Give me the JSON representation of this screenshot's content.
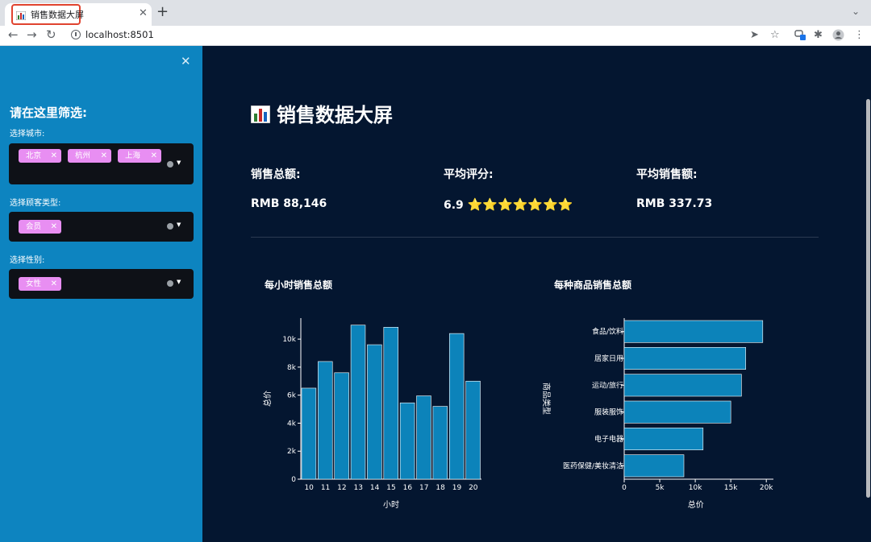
{
  "browser": {
    "tab_title": "销售数据大屏",
    "tab_close": "✕",
    "new_tab": "+",
    "url": "localhost:8501",
    "extension_badge": "0"
  },
  "sidebar": {
    "close": "✕",
    "title": "请在这里筛选:",
    "filters": [
      {
        "label": "选择城市:",
        "chips": [
          "北京",
          "杭州",
          "上海"
        ]
      },
      {
        "label": "选择顾客类型:",
        "chips": [
          "会员"
        ]
      },
      {
        "label": "选择性别:",
        "chips": [
          "女性"
        ]
      }
    ],
    "chip_color": "#e88ef2"
  },
  "main": {
    "title": "销售数据大屏",
    "kpis": [
      {
        "label": "销售总额:",
        "value": "RMB 88,146"
      },
      {
        "label": "平均评分:",
        "value": "6.9",
        "stars": "⭐⭐⭐⭐⭐⭐⭐"
      },
      {
        "label": "平均销售额:",
        "value": "RMB 337.73"
      }
    ]
  },
  "chart_data": [
    {
      "type": "bar",
      "title": "每小时销售总额",
      "xlabel": "小时",
      "ylabel": "总价",
      "categories": [
        "10",
        "11",
        "12",
        "13",
        "14",
        "15",
        "16",
        "17",
        "18",
        "19",
        "20"
      ],
      "values": [
        6500,
        8400,
        7600,
        11000,
        9600,
        10850,
        5450,
        5950,
        5200,
        10400,
        7000
      ],
      "ylim": [
        0,
        11500
      ],
      "yticks": [
        0,
        2000,
        4000,
        6000,
        8000,
        10000
      ],
      "ytick_labels": [
        "0",
        "2k",
        "4k",
        "6k",
        "8k",
        "10k"
      ],
      "bar_color": "#0c83ba"
    },
    {
      "type": "bar",
      "orientation": "horizontal",
      "title": "每种商品销售总额",
      "xlabel": "总价",
      "ylabel": "商品类型",
      "categories": [
        "食品/饮料",
        "居家日用",
        "运动/旅行",
        "服装服饰",
        "电子电器",
        "医药保健/美妆清洁"
      ],
      "values": [
        19500,
        17100,
        16500,
        15000,
        11100,
        8400
      ],
      "xlim": [
        0,
        21000
      ],
      "xticks": [
        0,
        5000,
        10000,
        15000,
        20000
      ],
      "xtick_labels": [
        "0",
        "5k",
        "10k",
        "15k",
        "20k"
      ],
      "bar_color": "#0c83ba"
    }
  ]
}
